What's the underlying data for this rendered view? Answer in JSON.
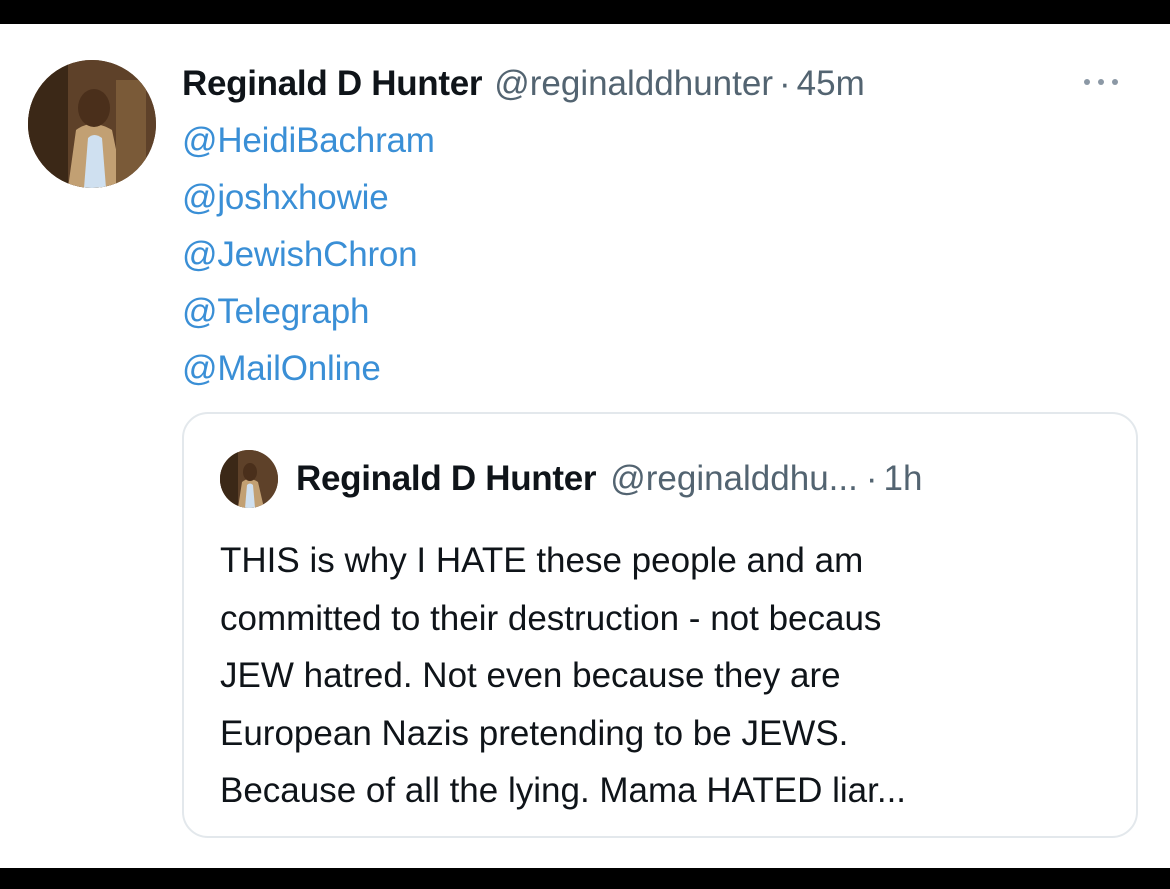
{
  "tweet": {
    "author_name": "Reginald D Hunter",
    "author_handle": "@reginalddhunter",
    "separator": "·",
    "time": "45m",
    "more_icon": "more-horizontal-icon",
    "mentions": [
      "@HeidiBachram",
      "@joshxhowie",
      "@JewishChron",
      "@Telegraph",
      "@MailOnline"
    ]
  },
  "quoted_tweet": {
    "author_name": "Reginald D Hunter",
    "author_handle": "@reginalddhu...",
    "separator": "·",
    "time": "1h",
    "text_lines": [
      "THIS is why I HATE these people and am",
      "committed to their destruction - not becaus",
      "JEW hatred. Not even because they are",
      "European Nazis  pretending to be JEWS.",
      "Because of all the lying. Mama HATED liar..."
    ]
  },
  "colors": {
    "link": "#3a8fd6",
    "secondary_text": "#536471",
    "primary_text": "#0f1419",
    "border": "#e3e8ec",
    "frame": "#000000"
  }
}
